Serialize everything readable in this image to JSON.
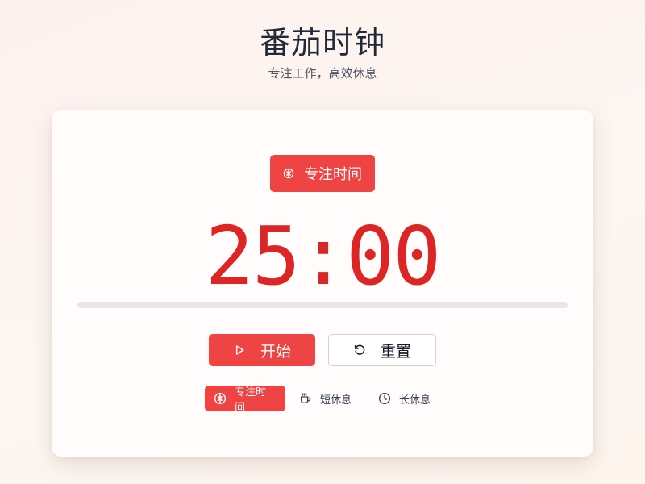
{
  "header": {
    "title": "番茄时钟",
    "subtitle": "专注工作，高效休息"
  },
  "timer": {
    "mode_label": "专注时间",
    "mode_icon": "brain-icon",
    "display": "25:00",
    "progress_fraction": 0
  },
  "controls": {
    "start_label": "开始",
    "start_icon": "play-icon",
    "reset_label": "重置",
    "reset_icon": "reset-icon"
  },
  "modes": [
    {
      "label": "专注时间",
      "icon": "brain-icon",
      "active": true
    },
    {
      "label": "短休息",
      "icon": "coffee-icon",
      "active": false
    },
    {
      "label": "长休息",
      "icon": "clock-icon",
      "active": false
    }
  ],
  "colors": {
    "accent": "#ef4444",
    "timer_text": "#dc2626",
    "track": "#e5e7eb"
  }
}
